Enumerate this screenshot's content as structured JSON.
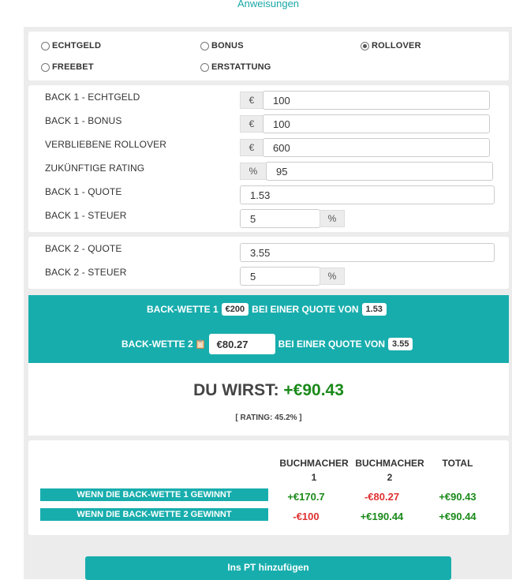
{
  "top_link": "Anweisungen",
  "bet_types": [
    {
      "label": "ECHTGELD",
      "checked": false
    },
    {
      "label": "BONUS",
      "checked": false
    },
    {
      "label": "ROLLOVER",
      "checked": true
    },
    {
      "label": "FREEBET",
      "checked": false
    },
    {
      "label": "ERSTATTUNG",
      "checked": false
    }
  ],
  "back1": {
    "echtgeld_label": "BACK 1 - ECHTGELD",
    "echtgeld_value": "100",
    "bonus_label": "BACK 1 - BONUS",
    "bonus_value": "100",
    "rollover_label": "VERBLIEBENE ROLLOVER",
    "rollover_value": "600",
    "rating_label": "ZUKÜNFTIGE RATING",
    "rating_value": "95",
    "quote_label": "BACK 1 - QUOTE",
    "quote_value": "1.53",
    "steuer_label": "BACK 1 - STEUER",
    "steuer_value": "5"
  },
  "back2": {
    "quote_label": "BACK 2 - QUOTE",
    "quote_value": "3.55",
    "steuer_label": "BACK 2 - STEUER",
    "steuer_value": "5"
  },
  "symbols": {
    "euro": "€",
    "percent": "%"
  },
  "summary": {
    "line1_prefix": "BACK-WETTE 1",
    "line1_stake": "€200",
    "line1_mid": "BEI EINER QUOTE VON",
    "line1_odds": "1.53",
    "line2_prefix": "BACK-WETTE 2",
    "line2_stake": "€80.27",
    "line2_mid": "BEI EINER QUOTE VON",
    "line2_odds": "3.55"
  },
  "result": {
    "prefix": "DU WIRST:",
    "amount": "+€90.43",
    "rating": "[ RATING: 45.2% ]"
  },
  "table": {
    "headers": [
      "BUCHMACHER 1",
      "BUCHMACHER 2",
      "TOTAL"
    ],
    "rows": [
      {
        "label": "WENN DIE BACK-WETTE 1 GEWINNT",
        "b1": "+€170.7",
        "b2": "-€80.27",
        "total": "+€90.43"
      },
      {
        "label": "WENN DIE BACK-WETTE 2 GEWINNT",
        "b1": "-€100",
        "b2": "+€190.44",
        "total": "+€90.44"
      }
    ]
  },
  "button_label": "Ins PT hinzufügen",
  "colors": {
    "accent": "#18adad",
    "positive": "#1a8a1a",
    "negative": "#e03030"
  }
}
